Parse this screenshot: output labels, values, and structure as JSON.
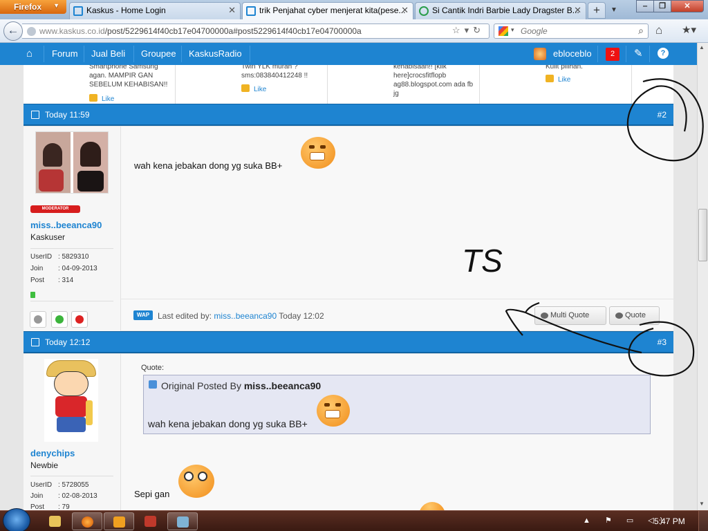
{
  "browser": {
    "app_button": "Firefox",
    "tabs": [
      {
        "title": "Kaskus - Home Login",
        "active": false
      },
      {
        "title": "trik Penjahat cyber menjerat kita(pese...",
        "active": true
      },
      {
        "title": "Si Cantik Indri Barbie Lady Dragster B...",
        "active": false
      }
    ],
    "url": {
      "host": "www.kaskus.co.id",
      "path": "/post/5229614f40cb17e04700000a#post5229614f40cb17e04700000a"
    },
    "search_placeholder": "Google",
    "accent": "#1e84d1"
  },
  "kaskus_nav": {
    "items": [
      "Forum",
      "Jual Beli",
      "Groupee",
      "KaskusRadio"
    ],
    "username": "ebloceblo",
    "notif_count": "2",
    "help": "?"
  },
  "prev_row": [
    {
      "text": "Smartphone Samsung agan. MAMPIR GAN SEBELUM KEHABISAN!!",
      "like": "Like"
    },
    {
      "text": "Twin YLK murah ? sms:083840412248 !!",
      "like": "Like"
    },
    {
      "text": "kehabisaan!! [klik here]crocsfitflopb ag88.blogspot.com ada fb jg",
      "like": ""
    },
    {
      "text": "Kulit pilihan.",
      "like": "Like"
    }
  ],
  "posts": [
    {
      "time": "Today 11:59",
      "number": "#2",
      "user": {
        "badge": "MODERATOR",
        "name": "miss..beeanca90",
        "rank": "Kaskuser",
        "stats": [
          {
            "k": "UserID",
            "v": ": 5829310"
          },
          {
            "k": "Join",
            "v": ": 04-09-2013"
          },
          {
            "k": "Post",
            "v": ": 314"
          }
        ]
      },
      "text": "wah kena jebakan dong yg suka BB+",
      "edited_prefix": "Last edited by:",
      "edited_user": "miss..beeanca90",
      "edited_time": "Today 12:02",
      "multi_quote": "Multi Quote",
      "quote": "Quote"
    },
    {
      "time": "Today 12:12",
      "number": "#3",
      "user": {
        "name": "denychips",
        "rank": "Newbie",
        "stats": [
          {
            "k": "UserID",
            "v": ": 5728055"
          },
          {
            "k": "Join",
            "v": ": 02-08-2013"
          },
          {
            "k": "Post",
            "v": ": 79"
          }
        ]
      },
      "quote_label": "Quote:",
      "quote_prefix": "Original Posted By",
      "quote_author": "miss..beeanca90",
      "quote_text": "wah kena jebakan dong yg suka BB+",
      "text": "Sepi gan"
    }
  ],
  "annotation": "TS",
  "taskbar": {
    "clock": "5:47 PM"
  }
}
